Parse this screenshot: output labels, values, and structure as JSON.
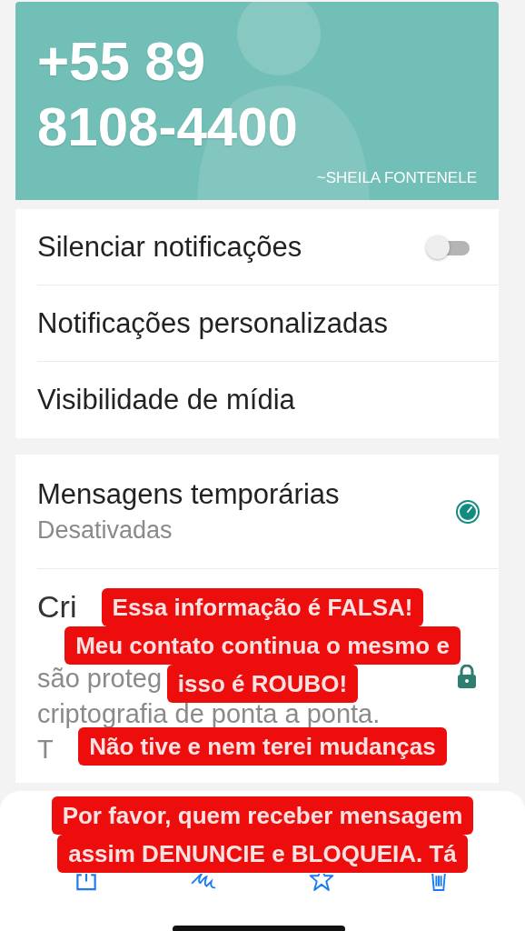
{
  "header": {
    "phone_line_1": "+55 89",
    "phone_line_2": "8108-4400",
    "name": "~SHEILA FONTENELE"
  },
  "settings": [
    {
      "kind": "toggle",
      "label": "Silenciar notificações",
      "on": false
    },
    {
      "kind": "plain",
      "label": "Notificações personalizadas"
    },
    {
      "kind": "plain",
      "label": "Visibilidade de mídia"
    }
  ],
  "disappearing": {
    "title": "Mensagens temporárias",
    "status": "Desativadas"
  },
  "encryption": {
    "title": "Cri",
    "lines": [
      "são proteg",
      "criptografia de ponta a ponta.",
      "T"
    ]
  },
  "captions": [
    {
      "lines": [
        "Essa informação é FALSA!",
        "Meu contato continua o mesmo e",
        "isso é ROUBO!"
      ]
    },
    {
      "lines": [
        "Não tive e nem terei mudanças"
      ]
    },
    {
      "lines": [
        "Por favor, quem receber mensagem",
        "assim DENUNCIE e BLOQUEIA. Tá"
      ]
    }
  ]
}
